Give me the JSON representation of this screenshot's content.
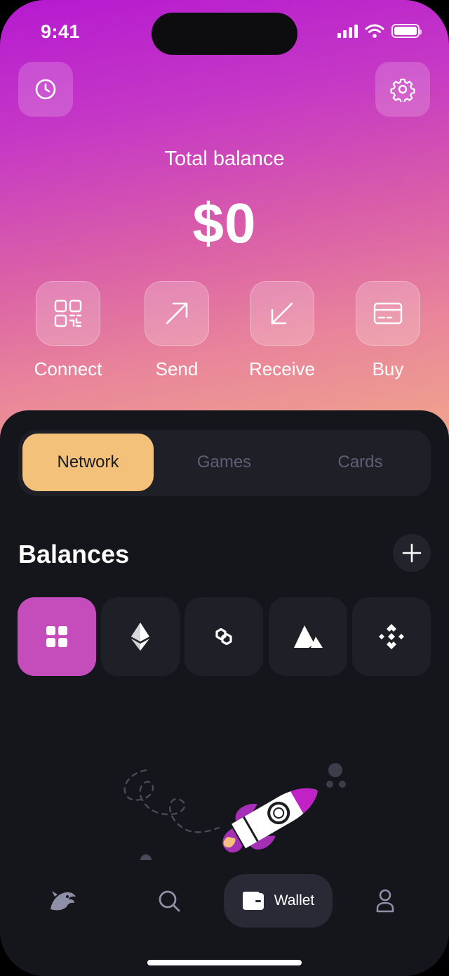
{
  "status_bar": {
    "time": "9:41"
  },
  "header": {
    "history_icon": "clock-icon",
    "settings_icon": "gear-icon",
    "total_label": "Total balance",
    "total_value": "$0"
  },
  "actions": [
    {
      "label": "Connect",
      "icon": "qr-code-icon"
    },
    {
      "label": "Send",
      "icon": "arrow-up-right-icon"
    },
    {
      "label": "Receive",
      "icon": "arrow-down-left-icon"
    },
    {
      "label": "Buy",
      "icon": "card-icon"
    }
  ],
  "tabs": [
    {
      "label": "Network",
      "active": true
    },
    {
      "label": "Games",
      "active": false
    },
    {
      "label": "Cards",
      "active": false
    }
  ],
  "balances": {
    "title": "Balances",
    "add_icon": "plus-icon",
    "networks": [
      {
        "icon": "all-networks-icon",
        "active": true
      },
      {
        "icon": "ethereum-icon",
        "active": false
      },
      {
        "icon": "polygon-icon",
        "active": false
      },
      {
        "icon": "avalanche-icon",
        "active": false
      },
      {
        "icon": "bnb-icon",
        "active": false
      }
    ]
  },
  "bottom_nav": {
    "items": [
      {
        "icon": "dragon-logo-icon"
      },
      {
        "icon": "search-icon"
      },
      {
        "icon": "wallet-icon",
        "label": "Wallet",
        "active": true
      },
      {
        "icon": "profile-icon"
      }
    ]
  },
  "colors": {
    "hero_gradient_start": "#b51ad0",
    "hero_gradient_end": "#f0a88a",
    "sheet_background": "#15151c",
    "active_tab": "#f3c179",
    "active_chip": "#c44dbb"
  }
}
